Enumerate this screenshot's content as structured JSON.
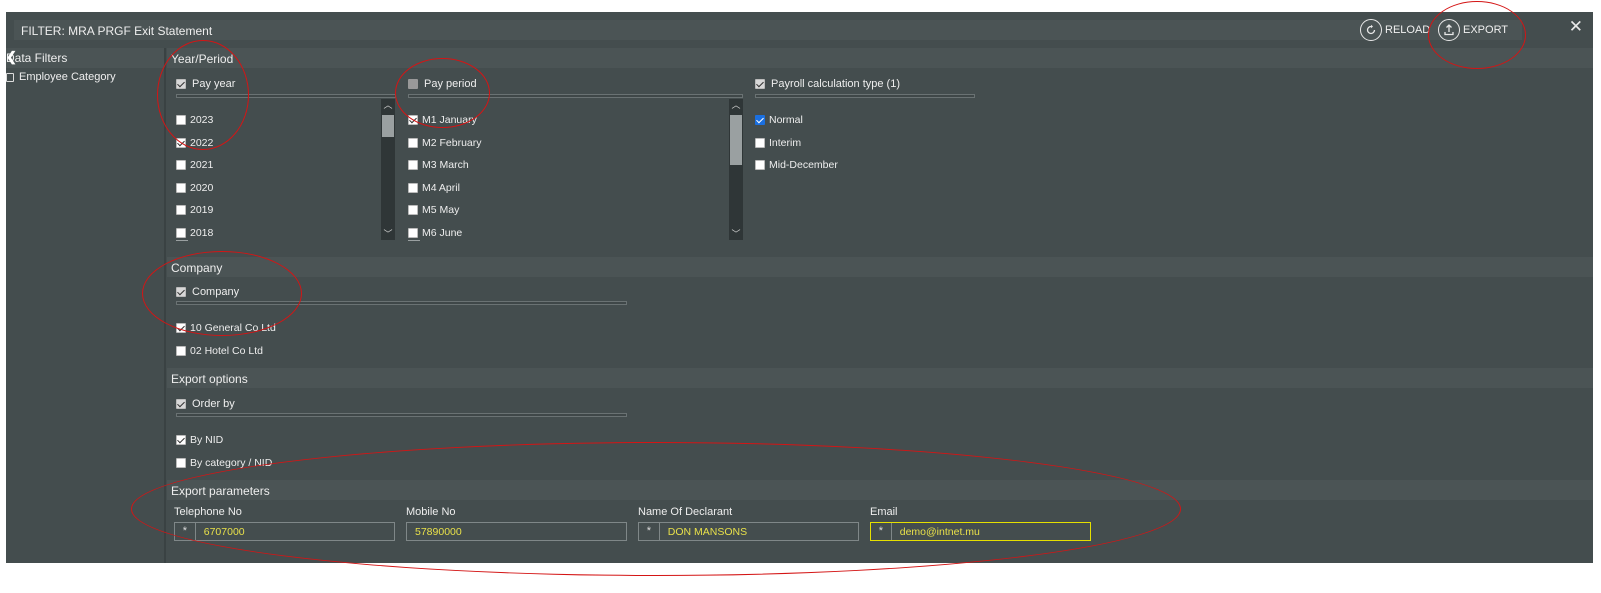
{
  "window": {
    "title": "FILTER: MRA PRGF Exit Statement",
    "reload_label": "RELOAD",
    "export_label": "EXPORT",
    "close_glyph": "✕"
  },
  "left_panel": {
    "title": "Data Filters",
    "collapse_glyph": "❮",
    "items": [
      {
        "label": "Employee Category"
      }
    ]
  },
  "sections": {
    "year_period": "Year/Period",
    "company": "Company",
    "export_options": "Export options",
    "export_parameters": "Export parameters"
  },
  "pay_year": {
    "header": "Pay year",
    "items": [
      {
        "label": "2023",
        "checked": false
      },
      {
        "label": "2022",
        "checked": true
      },
      {
        "label": "2021",
        "checked": false
      },
      {
        "label": "2020",
        "checked": false
      },
      {
        "label": "2019",
        "checked": false
      },
      {
        "label": "2018",
        "checked": false
      }
    ]
  },
  "pay_period": {
    "header": "Pay period",
    "items": [
      {
        "label": "M1 January",
        "checked": true
      },
      {
        "label": "M2 February",
        "checked": false
      },
      {
        "label": "M3 March",
        "checked": false
      },
      {
        "label": "M4 April",
        "checked": false
      },
      {
        "label": "M5 May",
        "checked": false
      },
      {
        "label": "M6 June",
        "checked": false
      }
    ]
  },
  "calc_type": {
    "header": "Payroll calculation type (1)",
    "items": [
      {
        "label": "Normal",
        "checked": true
      },
      {
        "label": "Interim",
        "checked": false
      },
      {
        "label": "Mid-December",
        "checked": false
      }
    ]
  },
  "company": {
    "header": "Company",
    "items": [
      {
        "label": "10 General Co Ltd",
        "checked": true
      },
      {
        "label": "02 Hotel Co Ltd",
        "checked": false
      }
    ]
  },
  "order_by": {
    "header": "Order by",
    "items": [
      {
        "label": "By NID",
        "checked": true
      },
      {
        "label": "By category / NID",
        "checked": false
      }
    ]
  },
  "export_params": {
    "telephone": {
      "label": "Telephone No",
      "value": "6707000",
      "required_mark": "*"
    },
    "mobile": {
      "label": "Mobile No",
      "value": "57890000"
    },
    "declarant": {
      "label": "Name Of Declarant",
      "value": "DON MANSONS",
      "required_mark": "*"
    },
    "email": {
      "label": "Email",
      "value": "demo@intnet.mu",
      "required_mark": "*"
    }
  },
  "colors": {
    "background": "#444d4e",
    "header_strip": "#4b5455",
    "annotation": "#d41515",
    "field_text": "#e8e04a",
    "focus_border": "#e6e000"
  }
}
